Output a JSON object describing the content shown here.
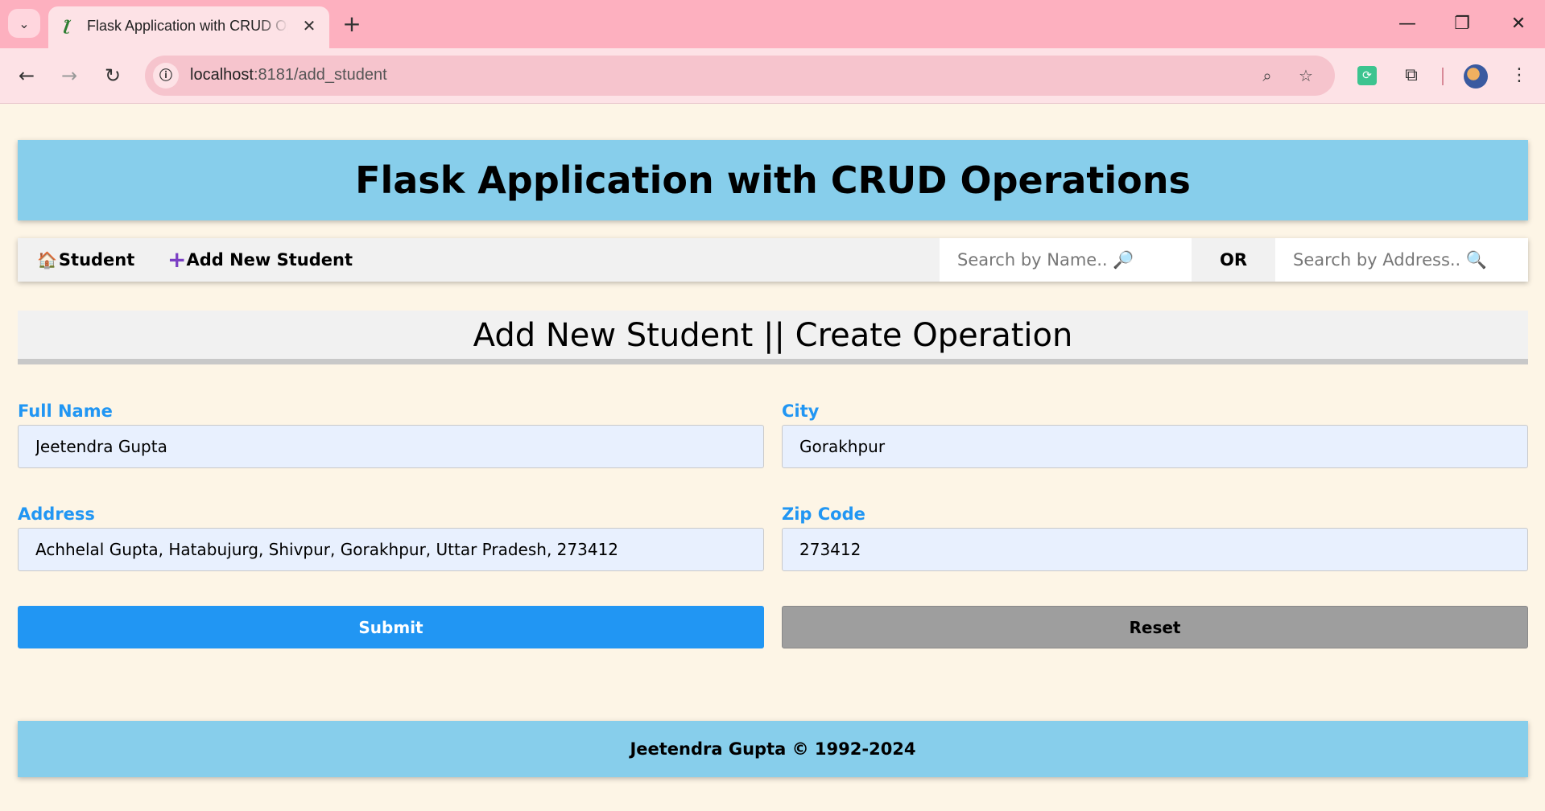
{
  "browser": {
    "tab": {
      "title": "Flask Application with CRUD Operations",
      "favicon": "flask-favicon-icon",
      "close_glyph": "✕"
    },
    "new_tab_glyph": "+",
    "tab_menu_glyph": "⌄",
    "url": {
      "host": "localhost",
      "path": ":8181/add_student"
    },
    "window_controls": {
      "minimize": "—",
      "maximize": "❐",
      "close": "✕"
    },
    "nav": {
      "back": "←",
      "forward": "→",
      "reload": "↻"
    },
    "omnibox_icons": {
      "zoom": "⌕",
      "bookmark": "☆",
      "info": "ⓘ"
    },
    "extensions": {
      "puzzle": "⧉",
      "menu": "⋮"
    }
  },
  "page": {
    "header_title": "Flask Application with CRUD Operations",
    "navbar": {
      "home_glyph": "🏠",
      "home_label": "Student",
      "add_glyph": "+",
      "add_label": "Add New Student",
      "search_name_placeholder": "Search by Name.. 🔎",
      "or_label": "OR",
      "search_address_placeholder": "Search by Address.. 🔍"
    },
    "section_title": "Add New Student || Create Operation",
    "form": {
      "full_name": {
        "label": "Full Name",
        "value": "Jeetendra Gupta"
      },
      "city": {
        "label": "City",
        "value": "Gorakhpur"
      },
      "address": {
        "label": "Address",
        "value": "Achhelal Gupta, Hatabujurg, Shivpur, Gorakhpur, Uttar Pradesh, 273412"
      },
      "zip_code": {
        "label": "Zip Code",
        "value": "273412"
      },
      "submit_label": "Submit",
      "reset_label": "Reset"
    },
    "footer_text": "Jeetendra Gupta © 1992-2024"
  },
  "colors": {
    "page_background": "#fdf5e6",
    "banner": "#87ceeb",
    "label_blue": "#2196f3",
    "submit_blue": "#2196f3",
    "reset_gray": "#9e9e9e",
    "input_background": "#e8f0fe",
    "tabstrip_pink": "#fdb0bf"
  }
}
